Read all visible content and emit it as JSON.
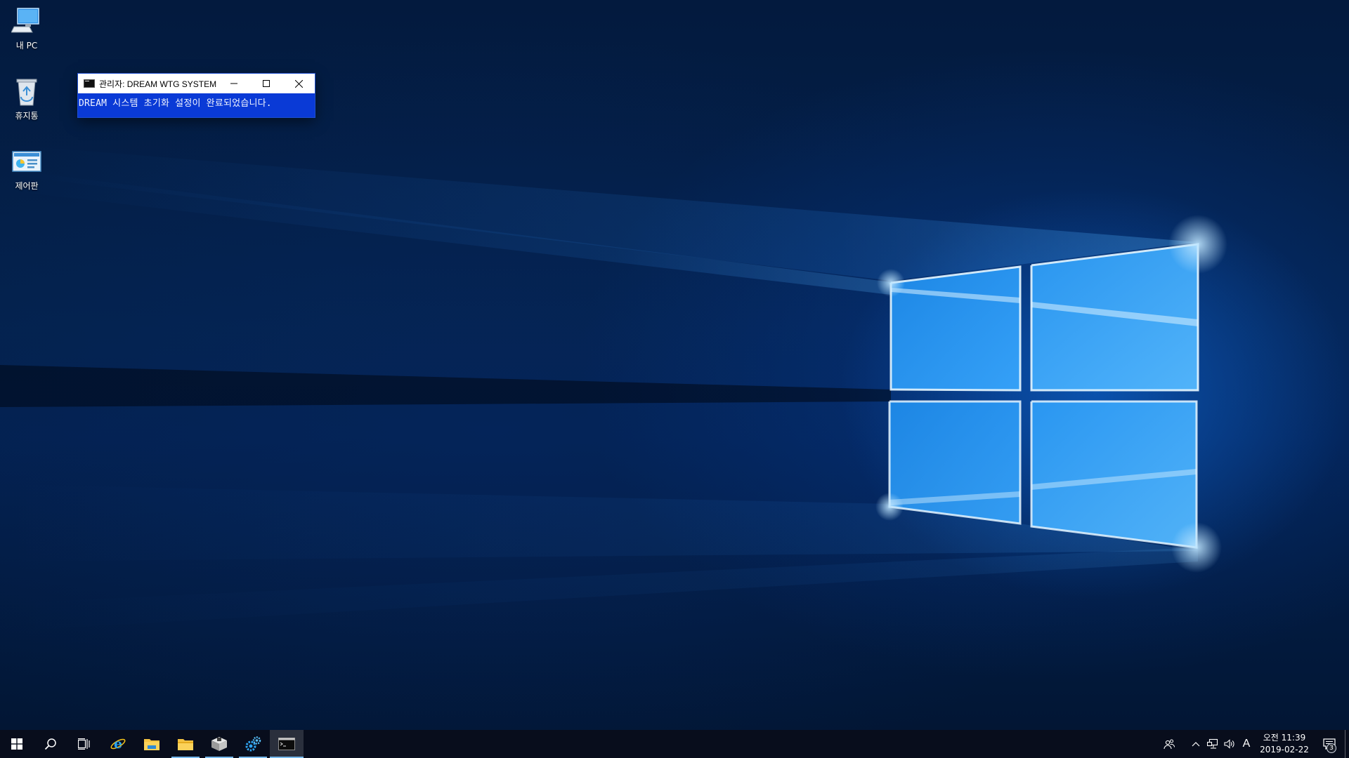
{
  "desktop": {
    "icons": [
      {
        "label": "내 PC",
        "icon": "this-pc-icon"
      },
      {
        "label": "휴지통",
        "icon": "recycle-bin-icon"
      },
      {
        "label": "제어판",
        "icon": "control-panel-icon"
      }
    ]
  },
  "console": {
    "title": "관리자:  DREAM WTG SYSTEM",
    "message": "DREAM 시스템 초기화 설정이 완료되었습니다.",
    "bg_color": "#0a3ad6"
  },
  "taskbar": {
    "apps": [
      {
        "icon": "internet-explorer-icon",
        "running": false
      },
      {
        "icon": "file-explorer-icon",
        "running": false
      },
      {
        "icon": "file-explorer-icon",
        "running": true
      },
      {
        "icon": "package-installer-icon",
        "running": true
      },
      {
        "icon": "settings-gears-icon",
        "running": true
      },
      {
        "icon": "command-prompt-icon",
        "running": true,
        "active": true
      }
    ],
    "ime": "A",
    "clock": {
      "time": "오전 11:39",
      "date": "2019-02-22"
    },
    "notification_count": "3",
    "accent": "#76b9ed"
  }
}
